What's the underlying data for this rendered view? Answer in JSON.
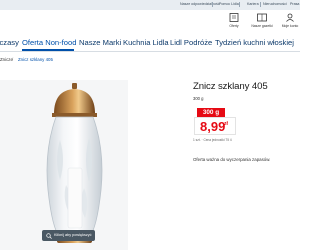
{
  "topbar": {
    "links": [
      "Nasze odpowiedzialność",
      "Pomoc Lidla",
      "Kariera",
      "Nieruchomości",
      "Prasa"
    ]
  },
  "header": {
    "icons": [
      {
        "label": "Oferty",
        "icon": "flyer-icon"
      },
      {
        "label": "Nasze gazetki",
        "icon": "newspaper-icon"
      },
      {
        "label": "Moje konto",
        "icon": "user-icon"
      }
    ]
  },
  "nav": {
    "items": [
      "wczasy",
      "Oferta Non-food",
      "Nasze Marki",
      "Kuchnia Lidla",
      "Lidl Podróże",
      "Tydzień kuchni włoskiej"
    ],
    "active_index": 1
  },
  "breadcrumb": {
    "items": [
      "Znicze",
      "Znicz szklany 405"
    ],
    "separator": "/"
  },
  "product": {
    "title": "Znicz szklany 405",
    "weight": "300 g",
    "old_price": "300 g",
    "price": "8,99",
    "currency": "zł",
    "unit_price": "1 szt. · Cena jednostki 75 4",
    "note": "Oferta ważna do wyczerpania zapasów."
  },
  "image": {
    "zoom_label": "Kliknij aby powiększyć"
  },
  "colors": {
    "brand_blue": "#0050aa",
    "price_red": "#e60a14",
    "topbar_bg": "#e8edf2"
  }
}
